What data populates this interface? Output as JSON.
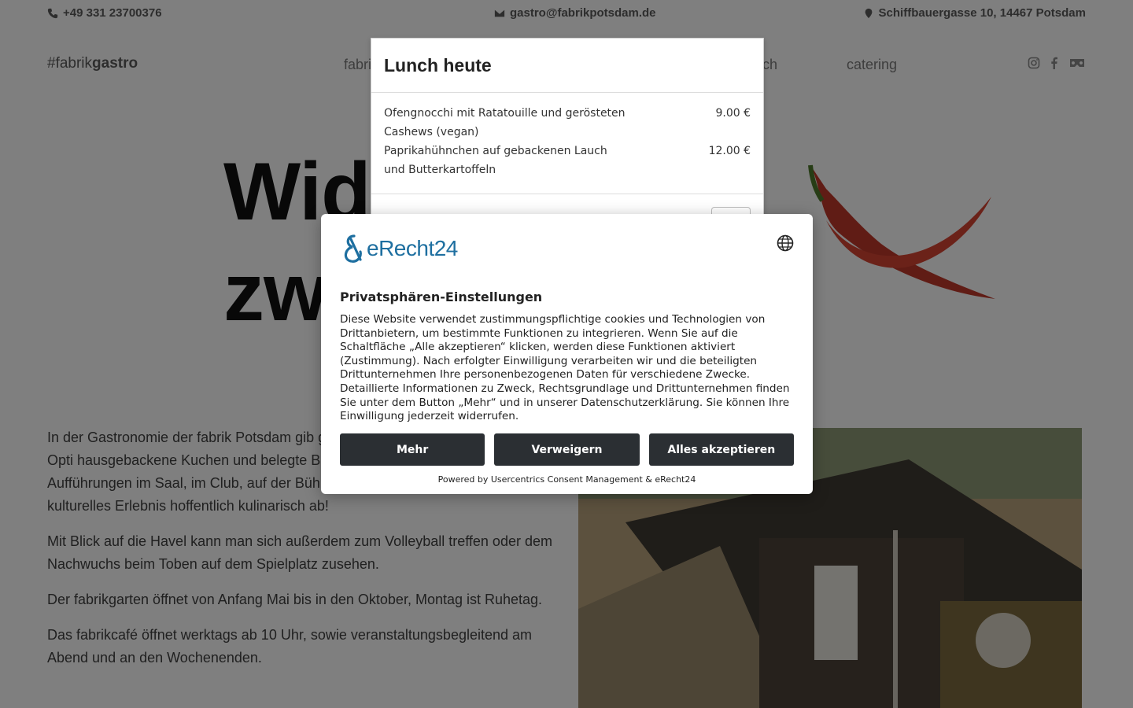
{
  "topbar": {
    "phone": "+49 331 23700376",
    "email": "gastro@fabrikpotsdam.de",
    "address": "Schiffbauergasse 10, 14467 Potsdam"
  },
  "nav": {
    "logo_prefix": "#fabrik",
    "logo_bold": "gastro",
    "links": [
      "fabrik",
      "lunch",
      "catering"
    ]
  },
  "hero": {
    "line1": "Wide",
    "line2": "zwe"
  },
  "content": {
    "paragraphs": [
      "In der Gastronomie der fabrik Potsdam gib gekochtes Lunchangebot mit veganer Opti hausgebackene Kuchen und belegte Brote vor oder nach den schönen Aufführungen im Saal, im Club, auf der Bühne im Biergarten und runden Euer kulturelles Erlebnis hoffentlich kulinarisch ab!",
      "Mit Blick auf die Havel kann man sich außerdem zum Volleyball treffen oder dem Nachwuchs beim Toben auf dem Spielplatz zusehen.",
      "Der fabrikgarten öffnet von Anfang Mai bis in den Oktober, Montag ist Ruhetag.",
      "Das fabrikcafé öffnet werktags ab 10 Uhr, sowie veranstaltungsbegleitend am Abend und an den Wochenenden."
    ]
  },
  "lunch": {
    "title": "Lunch heute",
    "dishes": [
      {
        "name": "Ofengnocchi mit Ratatouille und gerösteten Cashews (vegan)",
        "price": "9.00 €"
      },
      {
        "name": "Paprikahühnchen auf gebackenen Lauch und Butterkartoffeln",
        "price": "12.00 €"
      }
    ]
  },
  "consent": {
    "brand": "eRecht24",
    "title": "Privatsphären-Einstellungen",
    "text": "Diese Website verwendet zustimmungspflichtige cookies und Technologien von Drittanbietern, um bestimmte Funktionen zu integrieren. Wenn Sie auf die Schaltfläche „Alle akzeptieren“ klicken, werden diese Funktionen aktiviert (Zustimmung). Nach erfolgter Einwilligung verarbeiten wir und die beteiligten Drittunternehmen Ihre personenbezogenen Daten für verschiedene Zwecke. Detaillierte Informationen zu Zweck, Rechtsgrundlage und Drittunternehmen finden Sie unter dem Button „Mehr“ und in unserer Datenschutzerklärung. Sie können Ihre Einwilligung jederzeit widerrufen.",
    "buttons": {
      "more": "Mehr",
      "deny": "Verweigern",
      "accept": "Alles akzeptieren"
    },
    "powered": "Powered by Usercentrics Consent Management & eRecht24"
  },
  "colors": {
    "brand_blue": "#1e6fa0",
    "button_dark": "#2b2f33",
    "overlay": "rgba(0,0,0,0.5)"
  },
  "icons": [
    "phone-icon",
    "mail-icon",
    "map-pin-icon",
    "instagram-icon",
    "facebook-icon",
    "vr-icon",
    "globe-icon",
    "erecht24-logo-icon"
  ]
}
